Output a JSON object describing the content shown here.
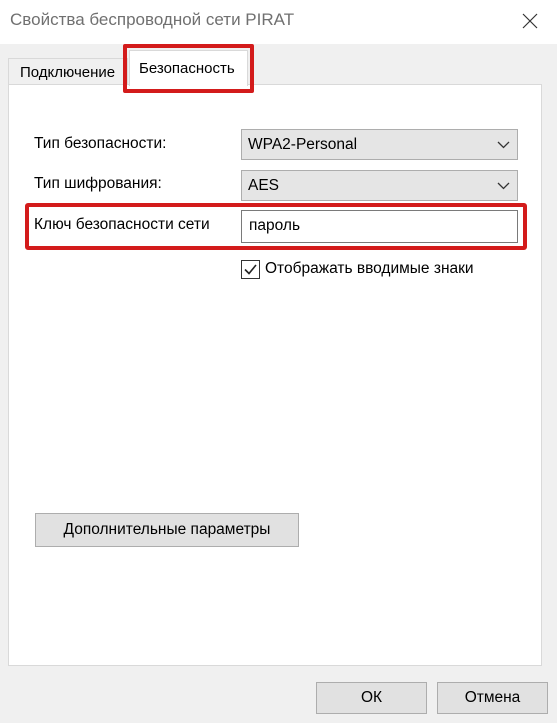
{
  "window": {
    "title": "Свойства беспроводной сети PIRAT",
    "close_icon": "close-icon"
  },
  "tabs": [
    {
      "label": "Подключение",
      "active": false
    },
    {
      "label": "Безопасность",
      "active": true
    }
  ],
  "security": {
    "type_label": "Тип безопасности:",
    "type_value": "WPA2-Personal",
    "encryption_label": "Тип шифрования:",
    "encryption_value": "AES",
    "key_label": "Ключ безопасности сети",
    "key_value": "пароль",
    "show_chars_label": "Отображать вводимые знаки",
    "show_chars_checked": true
  },
  "buttons": {
    "advanced": "Дополнительные параметры",
    "ok": "ОК",
    "cancel": "Отмена"
  },
  "colors": {
    "highlight": "#d31b1b",
    "panel_bg": "#ffffff",
    "window_bg": "#f0f0f0"
  }
}
